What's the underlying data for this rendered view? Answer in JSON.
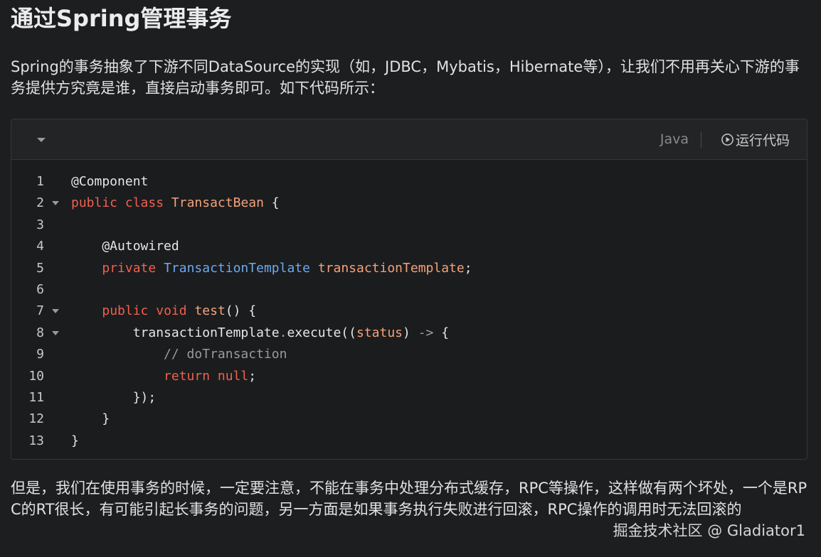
{
  "heading": "通过Spring管理事务",
  "intro_paragraph": "Spring的事务抽象了下游不同DataSource的实现（如，JDBC，Mybatis，Hibernate等），让我们不用再关心下游的事务提供方究竟是谁，直接启动事务即可。如下代码所示：",
  "code_block": {
    "language": "Java",
    "run_label": "运行代码",
    "lines": [
      {
        "number": "1",
        "foldable": false,
        "tokens": [
          {
            "t": "@Component",
            "c": "ann"
          }
        ]
      },
      {
        "number": "2",
        "foldable": true,
        "tokens": [
          {
            "t": "public",
            "c": "kw"
          },
          {
            "t": " ",
            "c": "punct"
          },
          {
            "t": "class",
            "c": "kw"
          },
          {
            "t": " ",
            "c": "punct"
          },
          {
            "t": "TransactBean",
            "c": "cls"
          },
          {
            "t": " {",
            "c": "punct"
          }
        ]
      },
      {
        "number": "3",
        "foldable": false,
        "tokens": []
      },
      {
        "number": "4",
        "foldable": false,
        "tokens": [
          {
            "t": "    @Autowired",
            "c": "ann"
          }
        ]
      },
      {
        "number": "5",
        "foldable": false,
        "tokens": [
          {
            "t": "    ",
            "c": "punct"
          },
          {
            "t": "private",
            "c": "kw"
          },
          {
            "t": " ",
            "c": "punct"
          },
          {
            "t": "TransactionTemplate",
            "c": "type"
          },
          {
            "t": " ",
            "c": "punct"
          },
          {
            "t": "transactionTemplate",
            "c": "var"
          },
          {
            "t": ";",
            "c": "punct"
          }
        ]
      },
      {
        "number": "6",
        "foldable": false,
        "tokens": []
      },
      {
        "number": "7",
        "foldable": true,
        "tokens": [
          {
            "t": "    ",
            "c": "punct"
          },
          {
            "t": "public",
            "c": "kw"
          },
          {
            "t": " ",
            "c": "punct"
          },
          {
            "t": "void",
            "c": "kw"
          },
          {
            "t": " ",
            "c": "punct"
          },
          {
            "t": "test",
            "c": "fn"
          },
          {
            "t": "() {",
            "c": "punct"
          }
        ]
      },
      {
        "number": "8",
        "foldable": true,
        "tokens": [
          {
            "t": "        transactionTemplate",
            "c": "punct"
          },
          {
            "t": ".",
            "c": "op"
          },
          {
            "t": "execute((",
            "c": "punct"
          },
          {
            "t": "status",
            "c": "param"
          },
          {
            "t": ") ",
            "c": "punct"
          },
          {
            "t": "->",
            "c": "op"
          },
          {
            "t": " {",
            "c": "punct"
          }
        ]
      },
      {
        "number": "9",
        "foldable": false,
        "tokens": [
          {
            "t": "            // doTransaction",
            "c": "cmt"
          }
        ]
      },
      {
        "number": "10",
        "foldable": false,
        "tokens": [
          {
            "t": "            ",
            "c": "punct"
          },
          {
            "t": "return",
            "c": "kw"
          },
          {
            "t": " ",
            "c": "punct"
          },
          {
            "t": "null",
            "c": "kw"
          },
          {
            "t": ";",
            "c": "punct"
          }
        ]
      },
      {
        "number": "11",
        "foldable": false,
        "tokens": [
          {
            "t": "        });",
            "c": "punct"
          }
        ]
      },
      {
        "number": "12",
        "foldable": false,
        "tokens": [
          {
            "t": "    }",
            "c": "punct"
          }
        ]
      },
      {
        "number": "13",
        "foldable": false,
        "tokens": [
          {
            "t": "}",
            "c": "punct"
          }
        ]
      }
    ]
  },
  "closing_paragraph": "但是，我们在使用事务的时候，一定要注意，不能在事务中处理分布式缓存，RPC等操作，这样做有两个坏处，一个是RPC的RT很长，有可能引起长事务的问题，另一方面是如果事务执行失败进行回滚，RPC操作的调用时无法回滚的",
  "watermark": "掘金技术社区 @ Gladiator1",
  "icons": {
    "collapse": "chevron-down-icon",
    "run": "play-circle-icon",
    "fold": "fold-caret-icon"
  },
  "colors": {
    "background": "#1d1e20",
    "keyword": "#f0604f",
    "type": "#6ea9ee",
    "identifier": "#f4a27b",
    "comment": "#9a9a9a"
  }
}
